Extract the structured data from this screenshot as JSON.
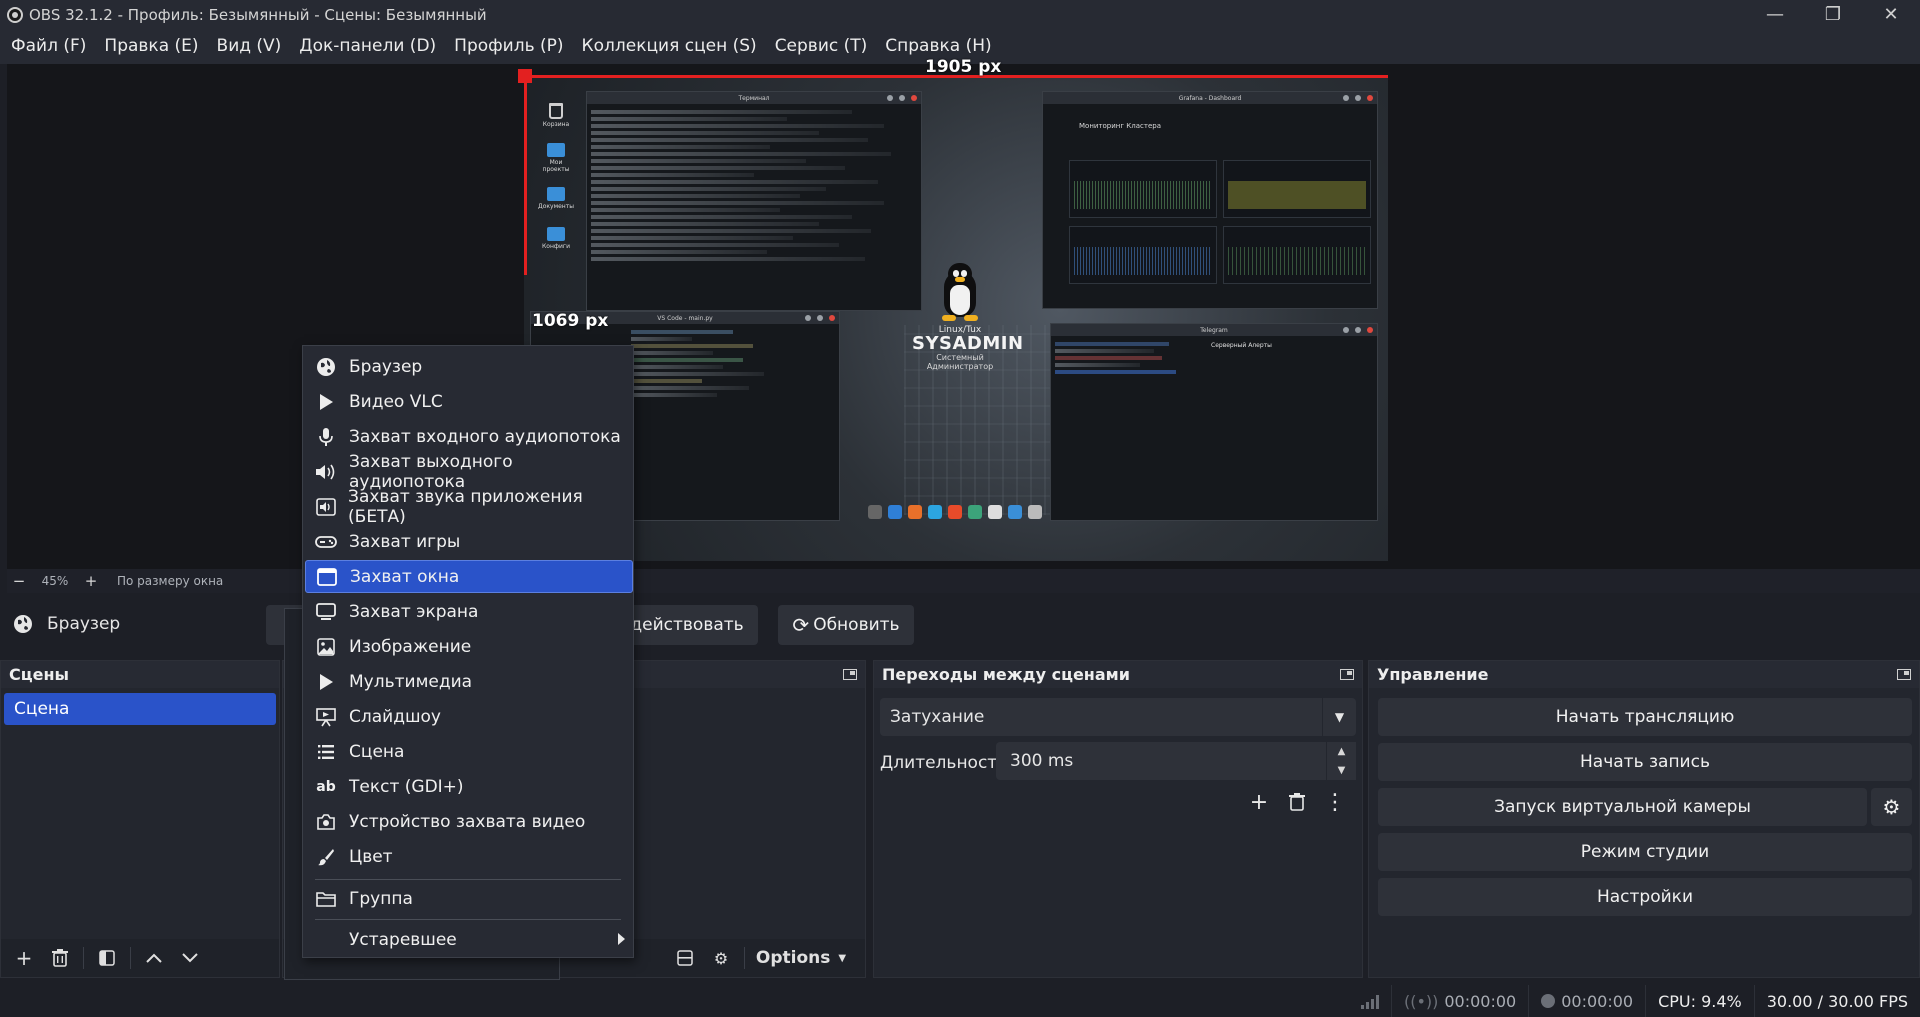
{
  "window": {
    "title": "OBS 32.1.2 - Профиль: Безымянный - Сцены: Безымянный",
    "minimize": "—",
    "maximize": "❐",
    "close": "✕"
  },
  "menubar": {
    "items": [
      "Файл (F)",
      "Правка (E)",
      "Вид (V)",
      "Док-панели (D)",
      "Профиль (P)",
      "Коллекция сцен (S)",
      "Сервис (T)",
      "Справка (H)"
    ]
  },
  "preview": {
    "width_label": "1905 px",
    "height_label": "1069 px",
    "terminal_title": "Терминал",
    "grafana_title": "Grafana - Dashboard",
    "grafana_heading": "Мониторинг Кластера",
    "vscode_title": "VS Code - main.py",
    "telegram_title": "Telegram",
    "telegram_channel": "Серверный Алерты",
    "desktop_icons": [
      "Корзина",
      "Мои проекты",
      "Документы",
      "Конфиги"
    ],
    "tux_caption": "Linux/Tux",
    "tux_brand": "SYSADMIN",
    "tux_subtitle": "Системный Администратор"
  },
  "zoom": {
    "minus": "−",
    "value": "45%",
    "plus": "+",
    "fit": "По размеру окна"
  },
  "source_toolbar": {
    "source_name": "Браузер",
    "interact_label": "одействовать",
    "refresh_label": "Обновить"
  },
  "docks": {
    "scenes": {
      "title": "Сцены",
      "items": [
        "Сцена"
      ]
    },
    "transitions": {
      "title": "Переходы между сценами",
      "selected": "Затухание",
      "duration_label": "Длительность",
      "duration_value": "300 ms"
    },
    "controls": {
      "title": "Управление",
      "buttons": [
        "Начать трансляцию",
        "Начать запись",
        "Запуск виртуальной камеры",
        "Режим студии",
        "Настройки"
      ]
    },
    "sources": {
      "options_label": "Options"
    }
  },
  "context_menu": {
    "items": [
      {
        "label": "Браузер",
        "icon": "globe-icon"
      },
      {
        "label": "Видео VLC",
        "icon": "play-icon"
      },
      {
        "label": "Захват входного аудиопотока",
        "icon": "microphone-icon"
      },
      {
        "label": "Захват выходного аудиопотока",
        "icon": "speaker-icon"
      },
      {
        "label": "Захват звука приложения (БЕТА)",
        "icon": "app-audio-icon"
      },
      {
        "label": "Захват игры",
        "icon": "gamepad-icon"
      },
      {
        "label": "Захват окна",
        "icon": "window-icon"
      },
      {
        "label": "Захват экрана",
        "icon": "monitor-icon"
      },
      {
        "label": "Изображение",
        "icon": "image-icon"
      },
      {
        "label": "Мультимедиа",
        "icon": "media-icon"
      },
      {
        "label": "Слайдшоу",
        "icon": "slideshow-icon"
      },
      {
        "label": "Сцена",
        "icon": "list-icon"
      },
      {
        "label": "Текст (GDI+)",
        "icon": "text-icon"
      },
      {
        "label": "Устройство захвата видео",
        "icon": "camera-icon"
      },
      {
        "label": "Цвет",
        "icon": "brush-icon"
      },
      {
        "label": "Группа",
        "icon": "folder-icon"
      },
      {
        "label": "Устаревшее",
        "icon": ""
      }
    ],
    "selected_index": 6
  },
  "statusbar": {
    "stream_time": "00:00:00",
    "record_time": "00:00:00",
    "cpu": "CPU: 9.4%",
    "fps": "30.00 / 30.00 FPS"
  },
  "colors": {
    "accent": "#2a53c9",
    "background": "#1d1f26",
    "panel": "#23262e",
    "button": "#2e3139",
    "selection_frame": "#e32020"
  }
}
